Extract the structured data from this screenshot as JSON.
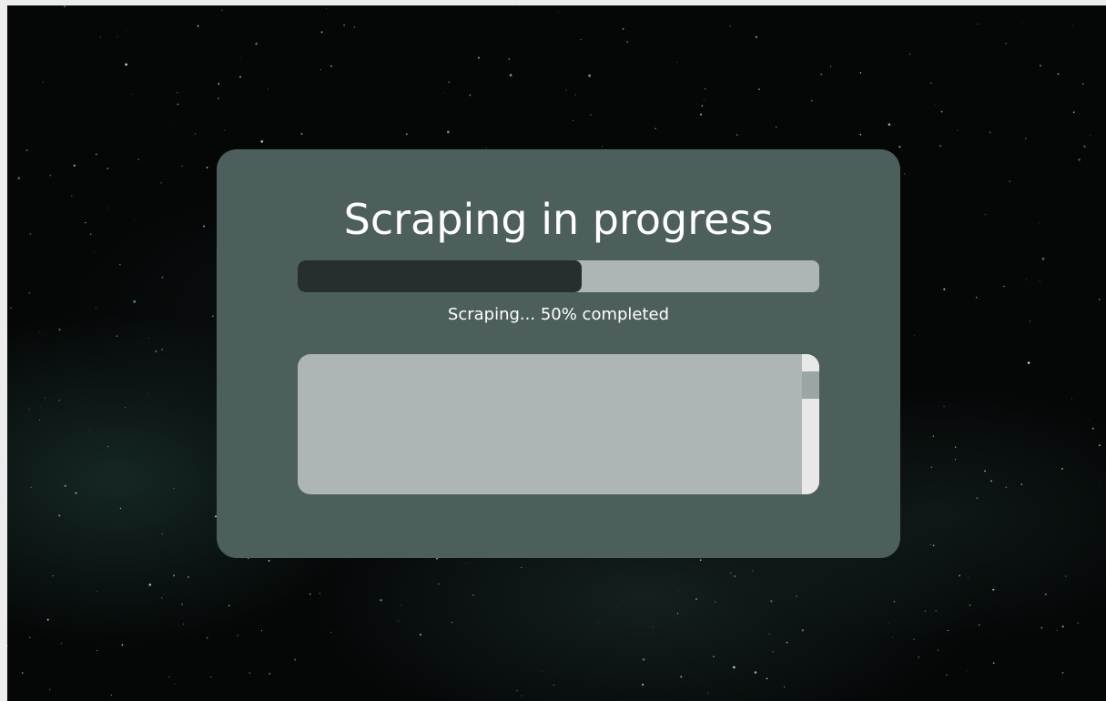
{
  "window": {
    "background_color": "#050707"
  },
  "card": {
    "background_color": "#4d5f5d",
    "title": "Scraping in progress",
    "progress": {
      "percent": 50,
      "track_color": "#adb5b5",
      "fill_color": "#262e2e"
    },
    "status_text": "Scraping... 50% completed",
    "log": {
      "lines": [],
      "scroll_position": 0.1
    }
  }
}
